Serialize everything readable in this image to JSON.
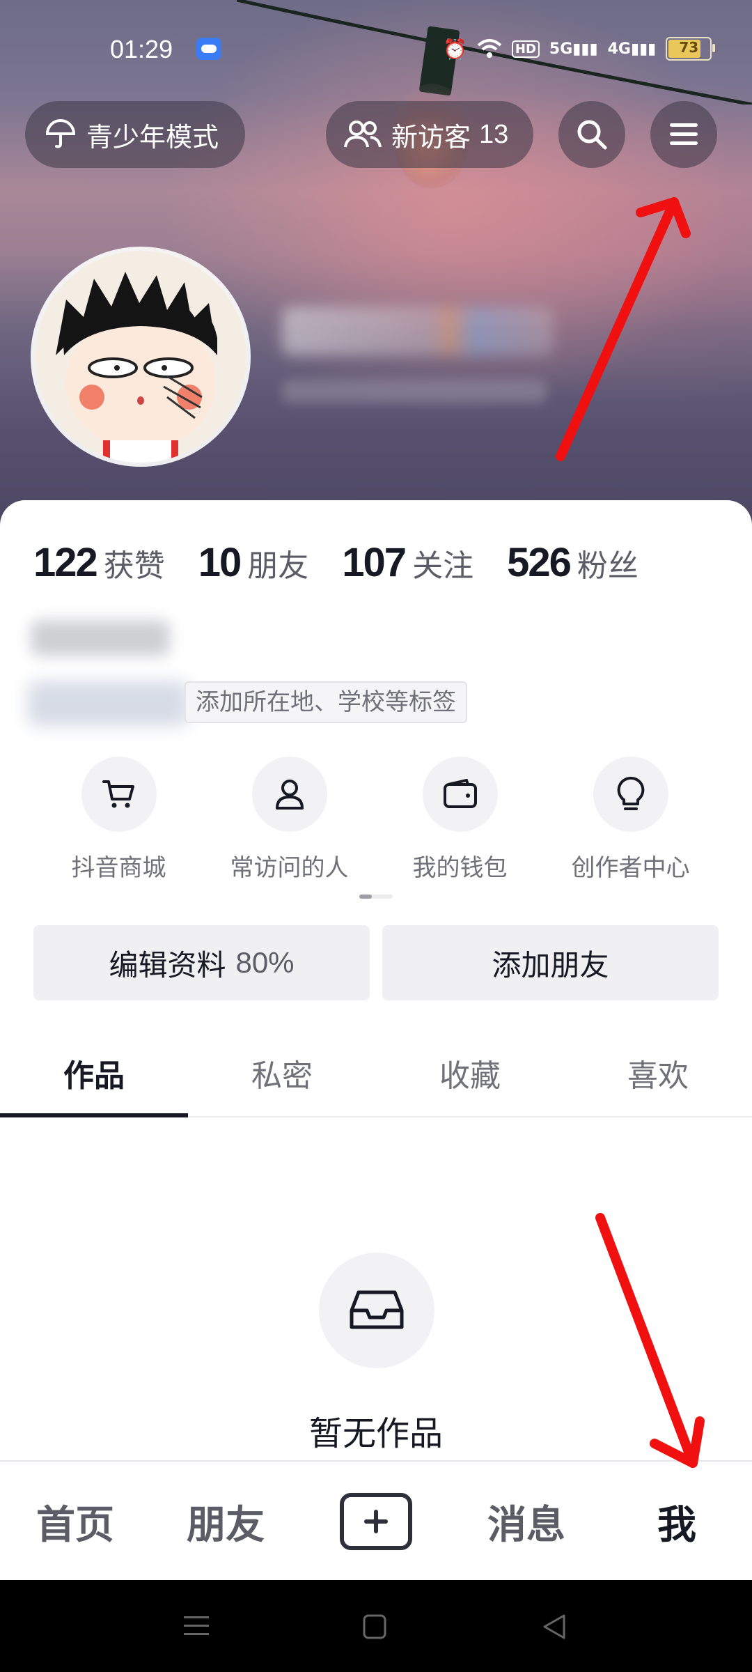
{
  "status_bar": {
    "time": "01:29",
    "network1": "5G",
    "network2": "4G",
    "hd_badge": "HD",
    "battery": "73"
  },
  "header": {
    "teen_mode_label": "青少年模式",
    "new_visitors_label": "新访客",
    "new_visitors_count": "13"
  },
  "stats": [
    {
      "value": "122",
      "label": "获赞"
    },
    {
      "value": "10",
      "label": "朋友"
    },
    {
      "value": "107",
      "label": "关注"
    },
    {
      "value": "526",
      "label": "粉丝"
    }
  ],
  "profile": {
    "tag_hint": "添加所在地、学校等标签"
  },
  "quick_actions": [
    {
      "label": "抖音商城",
      "icon": "cart-icon"
    },
    {
      "label": "常访问的人",
      "icon": "person-icon"
    },
    {
      "label": "我的钱包",
      "icon": "wallet-icon"
    },
    {
      "label": "创作者中心",
      "icon": "lightbulb-icon"
    }
  ],
  "buttons": {
    "edit_profile": "编辑资料",
    "edit_profile_percent": "80%",
    "add_friend": "添加朋友"
  },
  "tabs": [
    "作品",
    "私密",
    "收藏",
    "喜欢"
  ],
  "empty_state": {
    "text": "暂无作品"
  },
  "bottom_nav": {
    "home": "首页",
    "friends": "朋友",
    "messages": "消息",
    "me": "我"
  },
  "colors": {
    "annotation_arrow": "#f01010",
    "text_primary": "#161823",
    "text_secondary": "#6f7078"
  }
}
